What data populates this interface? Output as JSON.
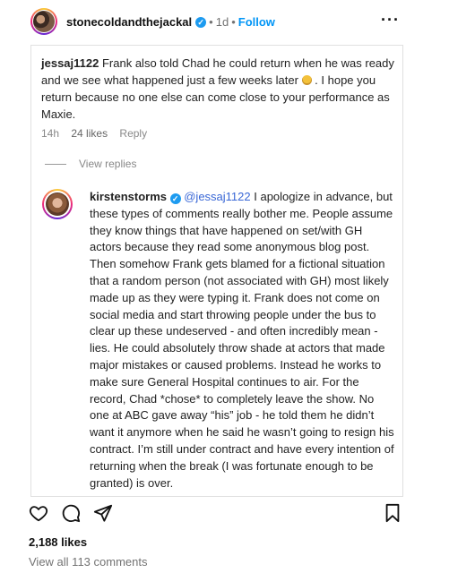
{
  "header": {
    "username": "stonecoldandthejackal",
    "verified_mark": "✓",
    "separator": "•",
    "time": "1d",
    "separator2": "•",
    "follow_label": "Follow",
    "more_label": "···"
  },
  "comment1": {
    "username": "jessaj1122",
    "text_part1": "Frank also told Chad he could return when he was ready and we see what happened just a few weeks later",
    "emoji": "face-icon",
    "text_part2": ". I hope you return because no one else can come close to your performance as Maxie.",
    "time": "14h",
    "likes": "24 likes",
    "reply": "Reply"
  },
  "view_replies": "View replies",
  "comment2": {
    "username": "kirstenstorms",
    "verified_mark": "✓",
    "mention": "@jessaj1122",
    "text": "I apologize in advance, but these types of comments really bother me. People assume they know things that have happened on set/with GH actors because they read some anonymous blog post. Then somehow Frank gets blamed for a fictional situation that a random person (not associated with GH) most likely made up as they were typing it. Frank does not come on social media and start throwing people under the bus to clear up these undeserved - and often incredibly mean - lies. He could absolutely throw shade at actors that made major mistakes or caused problems. Instead he works to make sure General Hospital continues to air. For the record, Chad *chose* to completely leave the show. No one at ABC gave away “his” job - he told them he didn’t want it anymore when he said he wasn’t going to resign his contract. I’m still under contract and have every intention of returning when the break (I was fortunate enough to be granted) is over."
  },
  "post": {
    "likes": "2,188 likes",
    "view_all_comments": "View all 113 comments"
  },
  "icons": [
    "heart-icon",
    "comment-icon",
    "share-icon",
    "bookmark-icon"
  ],
  "colors": {
    "link": "#0095f6",
    "verified": "#1d9bf0",
    "mention": "#3967d6",
    "muted": "#737373"
  }
}
